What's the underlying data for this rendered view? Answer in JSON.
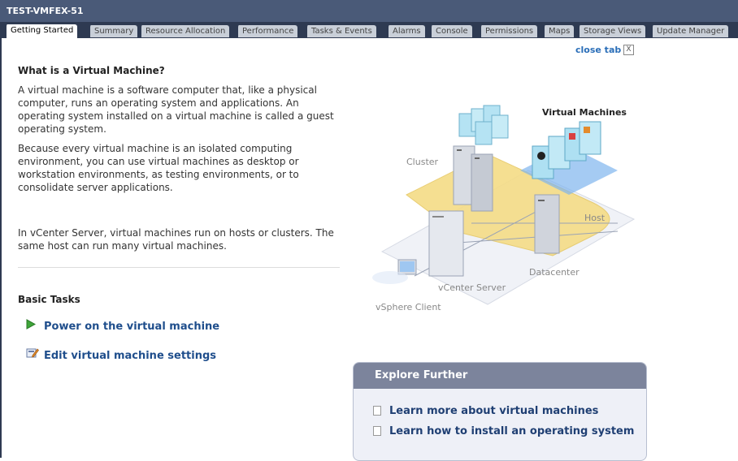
{
  "window": {
    "title": "TEST-VMFEX-51"
  },
  "tabs": [
    {
      "label": "Getting Started"
    },
    {
      "label": "Summary"
    },
    {
      "label": "Resource Allocation"
    },
    {
      "label": "Performance"
    },
    {
      "label": "Tasks & Events"
    },
    {
      "label": "Alarms"
    },
    {
      "label": "Console"
    },
    {
      "label": "Permissions"
    },
    {
      "label": "Maps"
    },
    {
      "label": "Storage Views"
    },
    {
      "label": "Update Manager"
    }
  ],
  "close_tab": {
    "label": "close tab",
    "icon": "close-box-icon",
    "glyph": "X"
  },
  "content": {
    "heading": "What is a Virtual Machine?",
    "paragraphs": [
      "A virtual machine is a software computer that, like a physical computer, runs an operating system and applications. An operating system installed on a virtual machine is called a guest operating system.",
      "Because every virtual machine is an isolated computing environment, you can use virtual machines as desktop or workstation environments, as testing environments, or to consolidate server applications.",
      "In vCenter Server, virtual machines run on hosts or clusters. The same host can run many virtual machines."
    ]
  },
  "basic_tasks": {
    "heading": "Basic Tasks",
    "items": [
      {
        "label": "Power on the virtual machine",
        "icon": "play-icon"
      },
      {
        "label": "Edit virtual machine settings",
        "icon": "edit-settings-icon"
      }
    ]
  },
  "diagram": {
    "labels": {
      "virtual_machines": "Virtual Machines",
      "cluster": "Cluster",
      "host": "Host",
      "datacenter": "Datacenter",
      "vcenter_server": "vCenter Server",
      "vsphere_client": "vSphere Client"
    }
  },
  "explore_further": {
    "heading": "Explore Further",
    "links": [
      {
        "label": "Learn more about virtual machines",
        "icon": "document-icon"
      },
      {
        "label": "Learn how to install an operating system",
        "icon": "document-icon"
      }
    ]
  },
  "colors": {
    "title_bar": "#4a5a78",
    "tab_strip": "#2e3a52",
    "link": "#1f4e8c",
    "cluster_zone": "#f5dc86",
    "explore_header": "#7c849c"
  }
}
